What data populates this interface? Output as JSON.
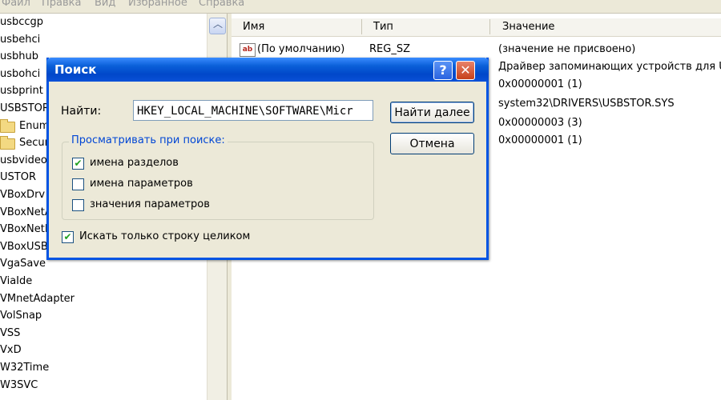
{
  "menu": [
    "Файл",
    "Правка",
    "Вид",
    "Избранное",
    "Справка"
  ],
  "tree": {
    "items": [
      {
        "label": "usbccgp",
        "folder": false
      },
      {
        "label": "usbehci",
        "folder": false
      },
      {
        "label": "usbhub",
        "folder": false
      },
      {
        "label": "usbohci",
        "folder": false
      },
      {
        "label": "usbprint",
        "folder": false
      },
      {
        "label": "USBSTOR",
        "folder": false
      },
      {
        "label": "Enum",
        "folder": true
      },
      {
        "label": "Security",
        "folder": true
      },
      {
        "label": "usbvideo",
        "folder": false
      },
      {
        "label": "USTOR",
        "folder": false
      },
      {
        "label": "VBoxDrv",
        "folder": false
      },
      {
        "label": "VBoxNetAdp",
        "folder": false
      },
      {
        "label": "VBoxNetFlt",
        "folder": false
      },
      {
        "label": "VBoxUSBMon",
        "folder": false
      },
      {
        "label": "VgaSave",
        "folder": false
      },
      {
        "label": "ViaIde",
        "folder": false
      },
      {
        "label": "VMnetAdapter",
        "folder": false
      },
      {
        "label": "VolSnap",
        "folder": false
      },
      {
        "label": "VSS",
        "folder": false
      },
      {
        "label": "VxD",
        "folder": false
      },
      {
        "label": "W32Time",
        "folder": false
      },
      {
        "label": "W3SVC",
        "folder": false
      }
    ]
  },
  "list": {
    "headers": {
      "name": "Имя",
      "type": "Тип",
      "value": "Значение"
    },
    "default_row": {
      "name": "(По умолчанию)",
      "type": "REG_SZ",
      "value": "(значение не присвоено)"
    },
    "values": [
      "Драйвер запоминающих устройств для USB",
      "0x00000001 (1)",
      "system32\\DRIVERS\\USBSTOR.SYS",
      "0x00000003 (3)",
      "0x00000001 (1)"
    ]
  },
  "dialog": {
    "title": "Поиск",
    "help_glyph": "?",
    "close_glyph": "✕",
    "find_label": "Найти:",
    "find_value": "HKEY_LOCAL_MACHINE\\SOFTWARE\\Micr",
    "find_next": "Найти далее",
    "cancel": "Отмена",
    "group_title": "Просматривать при поиске:",
    "options": [
      {
        "label": "имена разделов",
        "checked": true
      },
      {
        "label": "имена параметров",
        "checked": false
      },
      {
        "label": "значения параметров",
        "checked": false
      }
    ],
    "whole_string": {
      "label": "Искать только строку целиком",
      "checked": true
    }
  }
}
